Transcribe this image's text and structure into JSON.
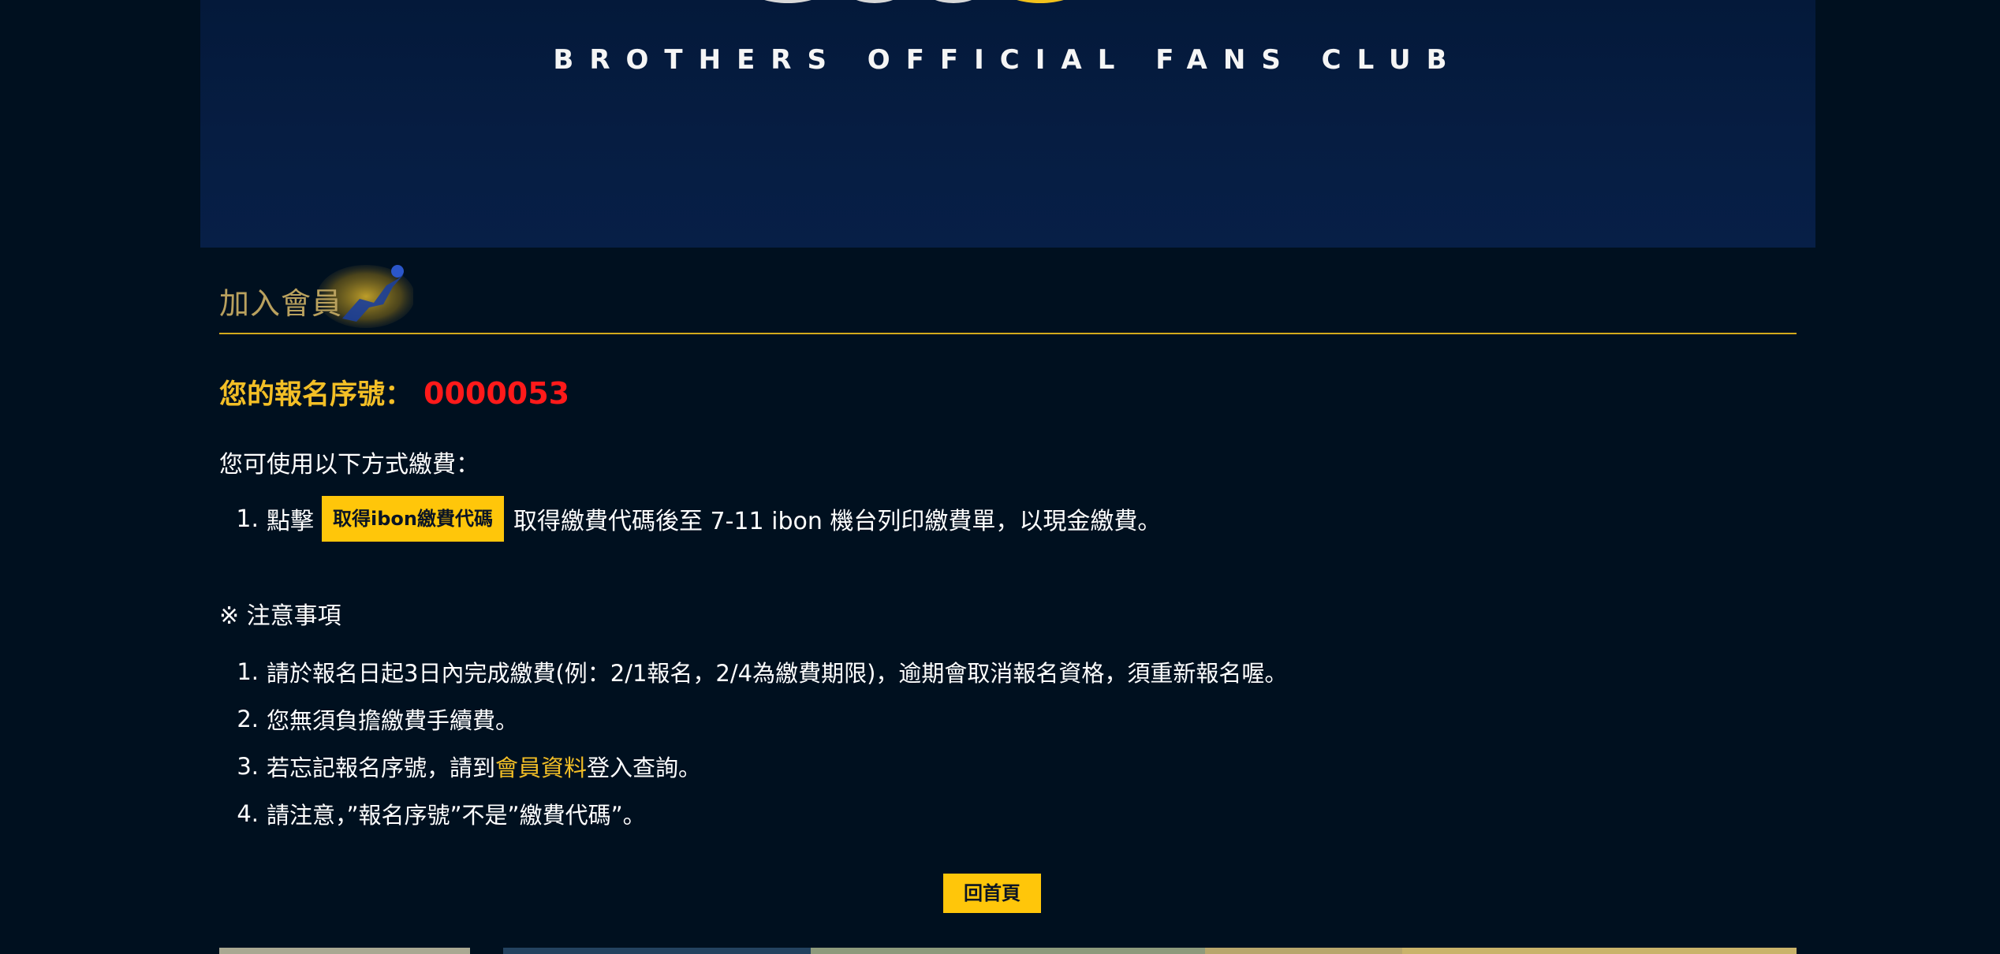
{
  "banner": {
    "title": "BROTHERS OFFICIAL FANS CLUB"
  },
  "section": {
    "title": "加入會員"
  },
  "registration": {
    "label": "您的報名序號：",
    "number": "0000053"
  },
  "payment": {
    "intro": "您可使用以下方式繳費：",
    "items": [
      {
        "num": "1.",
        "prefix": "點擊",
        "button_label": "取得ibon繳費代碼",
        "suffix": "取得繳費代碼後至 7-11 ibon 機台列印繳費單，以現金繳費。"
      }
    ]
  },
  "notice": {
    "title": "※ 注意事項",
    "items": [
      {
        "num": "1.",
        "text": "請於報名日起3日內完成繳費(例：2/1報名，2/4為繳費期限)，逾期會取消報名資格，須重新報名喔。"
      },
      {
        "num": "2.",
        "text": "您無須負擔繳費手續費。"
      },
      {
        "num": "3.",
        "text_before": "若忘記報名序號，請到",
        "link": "會員資料",
        "text_after": "登入查詢。"
      },
      {
        "num": "4.",
        "text": "請注意，”報名序號”不是”繳費代碼”。"
      }
    ]
  },
  "home_button": "回首頁",
  "colors": {
    "background": "#00101f",
    "banner": "#061d42",
    "accent_yellow": "#ffc60a",
    "highlight_text": "#f4bf26",
    "reg_number": "#ff1a1a"
  }
}
